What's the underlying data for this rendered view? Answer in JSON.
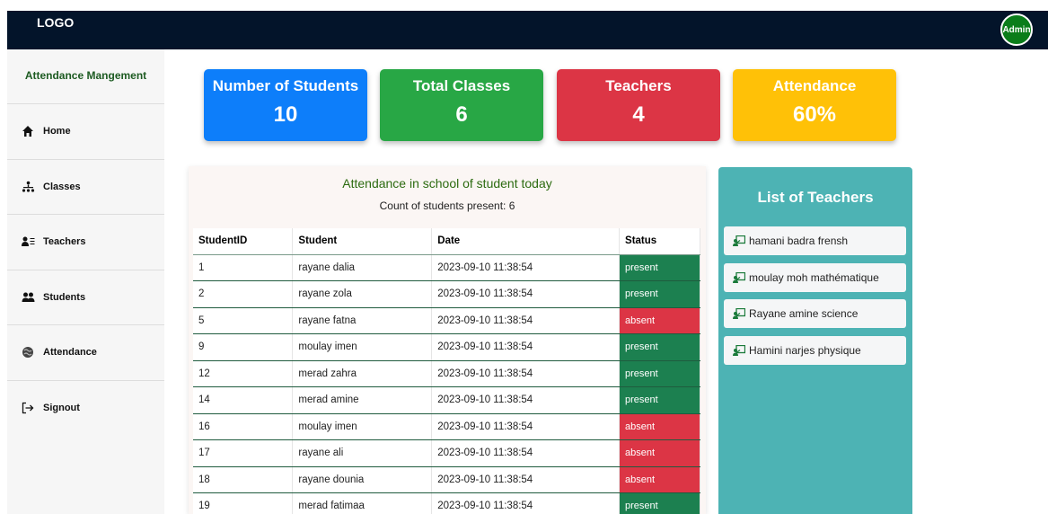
{
  "header": {
    "logo": "LOGO",
    "avatar_label": "Admin",
    "avatar_color": "#0a7d1a"
  },
  "sidebar": {
    "title": "Attendance Mangement",
    "items": [
      {
        "label": "Home",
        "icon": "home-icon"
      },
      {
        "label": "Classes",
        "icon": "classes-icon"
      },
      {
        "label": "Teachers",
        "icon": "teachers-icon"
      },
      {
        "label": "Students",
        "icon": "students-icon"
      },
      {
        "label": "Attendance",
        "icon": "attendance-icon"
      },
      {
        "label": "Signout",
        "icon": "signout-icon"
      }
    ]
  },
  "cards": [
    {
      "title": "Number of Students",
      "value": "10",
      "color": "#0d7efa"
    },
    {
      "title": "Total Classes",
      "value": "6",
      "color": "#28a745"
    },
    {
      "title": "Teachers",
      "value": "4",
      "color": "#dc3545"
    },
    {
      "title": "Attendance",
      "value": "60%",
      "color": "#ffc107"
    }
  ],
  "attendance": {
    "title": "Attendance in school of student today",
    "count_label": "Count of students present: 6",
    "columns": [
      "StudentID",
      "Student",
      "Date",
      "Status"
    ],
    "rows": [
      {
        "id": "1",
        "student": "rayane dalia",
        "date": "2023-09-10 11:38:54",
        "status": "present"
      },
      {
        "id": "2",
        "student": "rayane zola",
        "date": "2023-09-10 11:38:54",
        "status": "present"
      },
      {
        "id": "5",
        "student": "rayane fatna",
        "date": "2023-09-10 11:38:54",
        "status": "absent"
      },
      {
        "id": "9",
        "student": "moulay imen",
        "date": "2023-09-10 11:38:54",
        "status": "present"
      },
      {
        "id": "12",
        "student": "merad zahra",
        "date": "2023-09-10 11:38:54",
        "status": "present"
      },
      {
        "id": "14",
        "student": "merad amine",
        "date": "2023-09-10 11:38:54",
        "status": "present"
      },
      {
        "id": "16",
        "student": "moulay imen",
        "date": "2023-09-10 11:38:54",
        "status": "absent"
      },
      {
        "id": "17",
        "student": "rayane ali",
        "date": "2023-09-10 11:38:54",
        "status": "absent"
      },
      {
        "id": "18",
        "student": "rayane dounia",
        "date": "2023-09-10 11:38:54",
        "status": "absent"
      },
      {
        "id": "19",
        "student": "merad fatimaa",
        "date": "2023-09-10 11:38:54",
        "status": "present"
      }
    ],
    "status_colors": {
      "present": "#1c8050",
      "absent": "#dc3545"
    }
  },
  "teachers": {
    "title": "List of Teachers",
    "items": [
      "hamani badra frensh",
      "moulay moh mathématique",
      "Rayane amine science",
      "Hamini narjes physique"
    ]
  }
}
